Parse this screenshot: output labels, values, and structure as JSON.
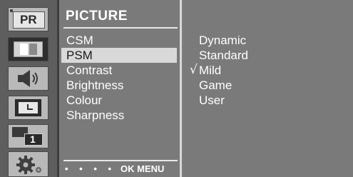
{
  "icons": [
    {
      "name": "pr-icon",
      "label": "PR"
    },
    {
      "name": "picture-icon"
    },
    {
      "name": "sound-icon"
    },
    {
      "name": "clock-icon"
    },
    {
      "name": "option-icon",
      "label": "1"
    },
    {
      "name": "setup-icon"
    }
  ],
  "menu": {
    "title": "PICTURE",
    "items": [
      "CSM",
      "PSM",
      "Contrast",
      "Brightness",
      "Colour",
      "Sharpness"
    ],
    "selected_index": 1,
    "footer_ok": "OK MENU"
  },
  "submenu": {
    "items": [
      "Dynamic",
      "Standard",
      "Mild",
      "Game",
      "User"
    ],
    "checked_index": 2,
    "check_mark": "√"
  },
  "colors": {
    "panel_bg": "#7a7a7a",
    "icon_column_bg": "#5e5e5e",
    "highlight": "#d9d9d9",
    "text": "#ffffff"
  }
}
